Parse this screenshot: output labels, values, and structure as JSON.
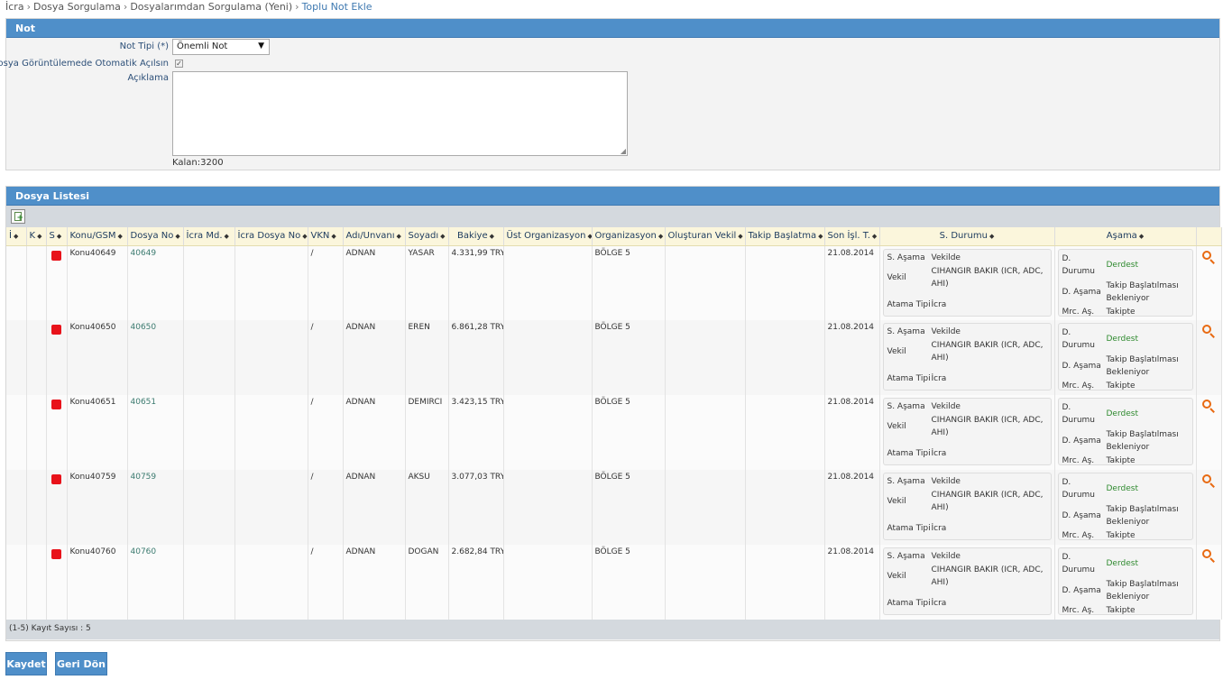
{
  "breadcrumb": [
    "İcra",
    "Dosya Sorgulama",
    "Dosyalarımdan Sorgulama (Yeni)",
    "Toplu Not Ekle"
  ],
  "note_panel": {
    "title": "Not",
    "note_type_label": "Not Tipi (*)",
    "note_type_value": "Önemli Not",
    "auto_open_label": "Dosya Görüntülemede Otomatik Açılsın",
    "auto_open_checked": true,
    "description_label": "Açıklama",
    "remaining": "Kalan:3200"
  },
  "list_panel": {
    "title": "Dosya Listesi",
    "columns": [
      "İ",
      "K",
      "S",
      "Konu/GSM",
      "Dosya No",
      "İcra Md.",
      "İcra Dosya No",
      "VKN",
      "Adı/Unvanı",
      "Soyadı",
      "Bakiye",
      "Üst Organizasyon",
      "Organizasyon",
      "Oluşturan Vekil",
      "Takip Başlatma",
      "Son İşl. T.",
      "S. Durumu",
      "Aşama"
    ],
    "s_labels": {
      "s_asama": "S. Aşama",
      "vekil": "Vekil",
      "atama_tipi": "Atama Tipi"
    },
    "a_labels": {
      "d_durumu": "D. Durumu",
      "d_asama": "D. Aşama",
      "mrc_as": "Mrc. Aş."
    },
    "rows": [
      {
        "konu": "Konu40649",
        "dosya_no": "40649",
        "vkn": "/",
        "adi": "ADNAN",
        "soyadi": "YASAR",
        "bakiye": "4.331,99 TRY",
        "org": "BÖLGE 5",
        "son": "21.08.2014",
        "s_asama": "Vekilde",
        "vekil": "CIHANGIR BAKIR (ICR, ADC, AHI)",
        "atama": "İcra",
        "d_durumu": "Derdest",
        "d_asama": "Takip Başlatılması Bekleniyor",
        "mrc": "Takipte"
      },
      {
        "konu": "Konu40650",
        "dosya_no": "40650",
        "vkn": "/",
        "adi": "ADNAN",
        "soyadi": "EREN",
        "bakiye": "6.861,28 TRY",
        "org": "BÖLGE 5",
        "son": "21.08.2014",
        "s_asama": "Vekilde",
        "vekil": "CIHANGIR BAKIR (ICR, ADC, AHI)",
        "atama": "İcra",
        "d_durumu": "Derdest",
        "d_asama": "Takip Başlatılması Bekleniyor",
        "mrc": "Takipte"
      },
      {
        "konu": "Konu40651",
        "dosya_no": "40651",
        "vkn": "/",
        "adi": "ADNAN",
        "soyadi": "DEMIRCI",
        "bakiye": "3.423,15 TRY",
        "org": "BÖLGE 5",
        "son": "21.08.2014",
        "s_asama": "Vekilde",
        "vekil": "CIHANGIR BAKIR (ICR, ADC, AHI)",
        "atama": "İcra",
        "d_durumu": "Derdest",
        "d_asama": "Takip Başlatılması Bekleniyor",
        "mrc": "Takipte"
      },
      {
        "konu": "Konu40759",
        "dosya_no": "40759",
        "vkn": "/",
        "adi": "ADNAN",
        "soyadi": "AKSU",
        "bakiye": "3.077,03 TRY",
        "org": "BÖLGE 5",
        "son": "21.08.2014",
        "s_asama": "Vekilde",
        "vekil": "CIHANGIR BAKIR (ICR, ADC, AHI)",
        "atama": "İcra",
        "d_durumu": "Derdest",
        "d_asama": "Takip Başlatılması Bekleniyor",
        "mrc": "Takipte"
      },
      {
        "konu": "Konu40760",
        "dosya_no": "40760",
        "vkn": "/",
        "adi": "ADNAN",
        "soyadi": "DOGAN",
        "bakiye": "2.682,84 TRY",
        "org": "BÖLGE 5",
        "son": "21.08.2014",
        "s_asama": "Vekilde",
        "vekil": "CIHANGIR BAKIR (ICR, ADC, AHI)",
        "atama": "İcra",
        "d_durumu": "Derdest",
        "d_asama": "Takip Başlatılması Bekleniyor",
        "mrc": "Takipte"
      }
    ],
    "record_count": "(1-5) Kayıt Sayısı : 5"
  },
  "buttons": {
    "save": "Kaydet",
    "back": "Geri Dön"
  },
  "colors": {
    "header_blue": "#4f8fc9",
    "status_red": "#e8121a",
    "derdest_green": "#2f8a2f",
    "search_orange": "#e86a12"
  },
  "icons": {
    "add": "add-document-icon",
    "search": "magnifier-icon",
    "sort": "sort-icon"
  }
}
